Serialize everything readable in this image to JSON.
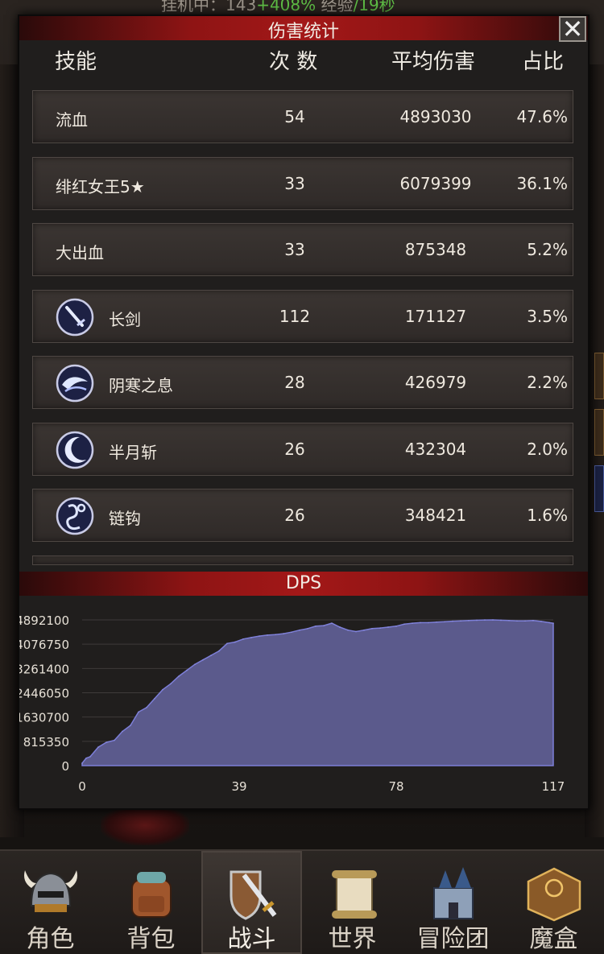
{
  "background": {
    "status_prefix": "挂机中：143",
    "status_green_1": "+408%",
    "status_mid": " 经验",
    "status_green_2": "/19秒"
  },
  "dialog": {
    "title": "伤害统计",
    "close_icon": "close-icon",
    "columns": {
      "skill": "技能",
      "count": "次 数",
      "avg": "平均伤害",
      "ratio": "占比"
    },
    "rows": [
      {
        "name": "流血",
        "count": "54",
        "avg": "4893030",
        "ratio": "47.6%",
        "icon": ""
      },
      {
        "name": "绯红女王5★",
        "count": "33",
        "avg": "6079399",
        "ratio": "36.1%",
        "icon": ""
      },
      {
        "name": "大出血",
        "count": "33",
        "avg": "875348",
        "ratio": "5.2%",
        "icon": ""
      },
      {
        "name": "长剑",
        "count": "112",
        "avg": "171127",
        "ratio": "3.5%",
        "icon": "sword-icon"
      },
      {
        "name": "阴寒之息",
        "count": "28",
        "avg": "426979",
        "ratio": "2.2%",
        "icon": "frost-breath-icon"
      },
      {
        "name": "半月斩",
        "count": "26",
        "avg": "432304",
        "ratio": "2.0%",
        "icon": "crescent-moon-icon"
      },
      {
        "name": "链钩",
        "count": "26",
        "avg": "348421",
        "ratio": "1.6%",
        "icon": "chain-hook-icon"
      }
    ]
  },
  "dps": {
    "title": "DPS",
    "chart_data": {
      "type": "area",
      "title": "DPS",
      "xlabel": "",
      "ylabel": "",
      "xlim": [
        0,
        117
      ],
      "ylim": [
        0,
        4892100
      ],
      "x_ticks": [
        "0",
        "39",
        "78",
        "117"
      ],
      "y_ticks": [
        "0",
        "815350",
        "1630700",
        "2446050",
        "3261400",
        "4076750",
        "4892100"
      ],
      "grid": true,
      "series": [
        {
          "color": "#5b5a8c",
          "x": [
            0,
            1,
            2,
            4,
            6,
            8,
            10,
            12,
            14,
            16,
            18,
            20,
            22,
            24,
            26,
            28,
            30,
            32,
            34,
            36,
            38,
            40,
            42,
            44,
            46,
            48,
            50,
            52,
            54,
            56,
            58,
            60,
            62,
            64,
            66,
            68,
            70,
            72,
            74,
            76,
            78,
            80,
            82,
            84,
            86,
            88,
            90,
            92,
            94,
            96,
            98,
            100,
            102,
            104,
            106,
            108,
            110,
            112,
            114,
            116,
            117
          ],
          "y": [
            80000,
            250000,
            300000,
            620000,
            780000,
            850000,
            1150000,
            1350000,
            1800000,
            1950000,
            2250000,
            2550000,
            2750000,
            3000000,
            3200000,
            3400000,
            3550000,
            3700000,
            3850000,
            4100000,
            4150000,
            4250000,
            4300000,
            4350000,
            4380000,
            4400000,
            4430000,
            4480000,
            4550000,
            4600000,
            4680000,
            4700000,
            4780000,
            4650000,
            4550000,
            4500000,
            4550000,
            4600000,
            4620000,
            4650000,
            4680000,
            4750000,
            4780000,
            4800000,
            4800000,
            4820000,
            4830000,
            4850000,
            4860000,
            4870000,
            4880000,
            4890000,
            4892100,
            4880000,
            4870000,
            4860000,
            4860000,
            4870000,
            4840000,
            4800000,
            4780000
          ]
        }
      ]
    }
  },
  "navbar": {
    "tabs": [
      {
        "label": "角色",
        "icon": "helmet-icon"
      },
      {
        "label": "背包",
        "icon": "backpack-icon"
      },
      {
        "label": "战斗",
        "icon": "shield-sword-icon"
      },
      {
        "label": "世界",
        "icon": "scroll-map-icon"
      },
      {
        "label": "冒险团",
        "icon": "castle-icon"
      },
      {
        "label": "魔盒",
        "icon": "magic-box-icon"
      }
    ],
    "selected": "战斗"
  }
}
